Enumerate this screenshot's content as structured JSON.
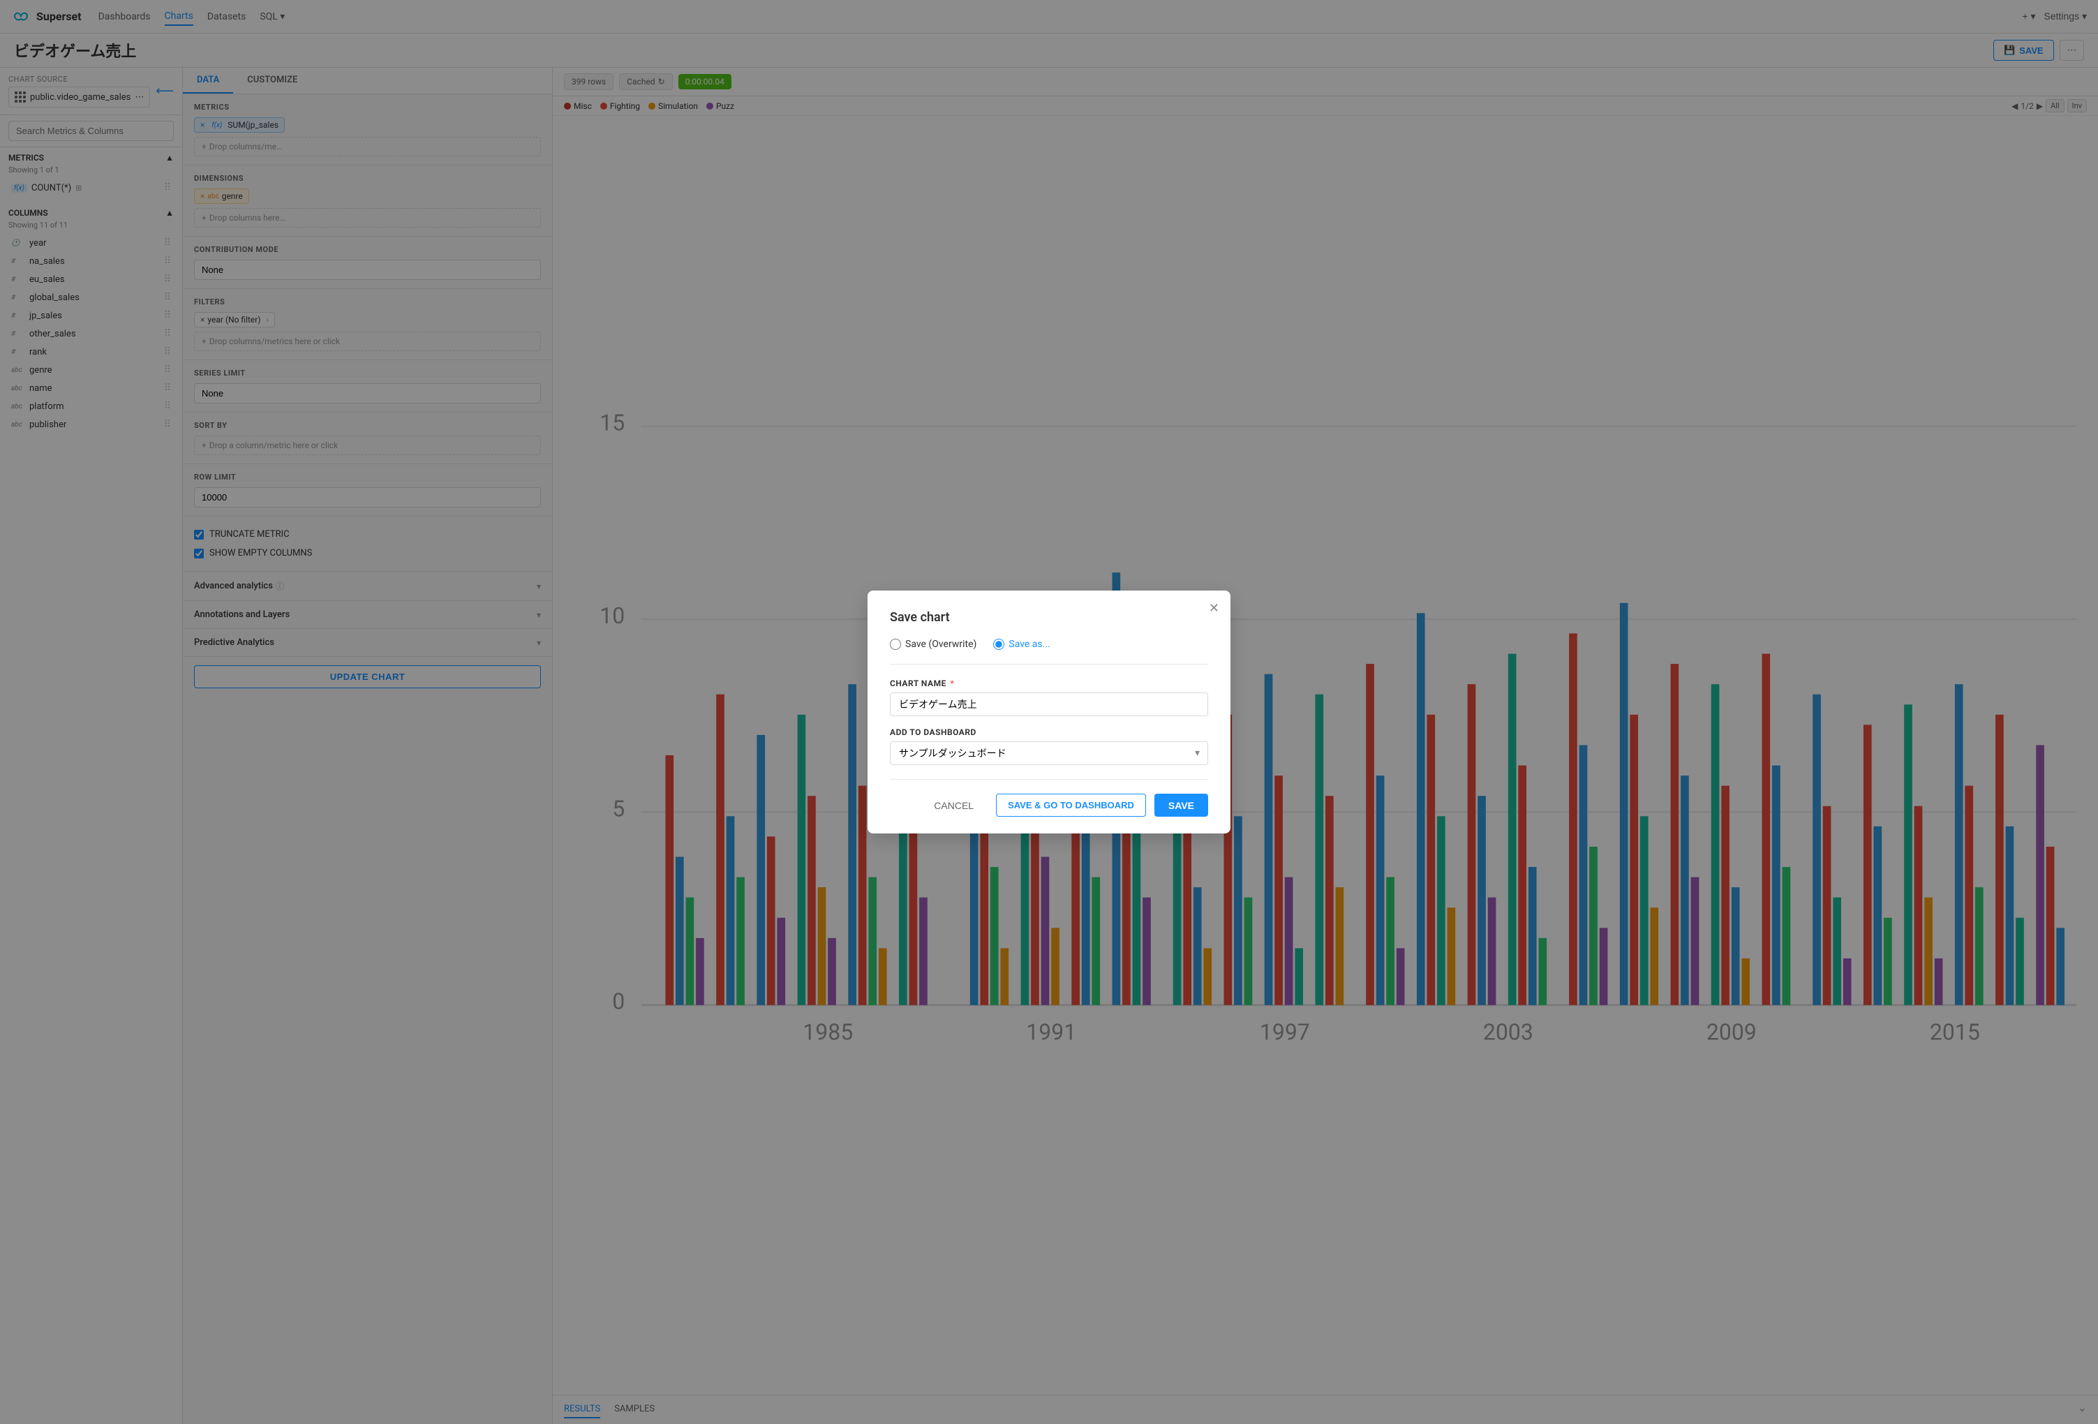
{
  "app": {
    "logo_text": "Superset"
  },
  "nav": {
    "links": [
      {
        "id": "dashboards",
        "label": "Dashboards",
        "active": false
      },
      {
        "id": "charts",
        "label": "Charts",
        "active": true
      },
      {
        "id": "datasets",
        "label": "Datasets",
        "active": false
      },
      {
        "id": "sql",
        "label": "SQL ▾",
        "active": false
      }
    ],
    "right": {
      "add_label": "+ ▾",
      "settings_label": "Settings ▾"
    }
  },
  "page": {
    "title": "ビデオゲーム売上",
    "save_label": "SAVE"
  },
  "sidebar": {
    "source_label": "Chart Source",
    "source_value": "public.video_game_sales",
    "search_placeholder": "Search Metrics & Columns",
    "metrics_label": "Metrics",
    "metrics_count": "Showing 1 of 1",
    "metrics": [
      {
        "label": "COUNT(*)",
        "type": "f(x)"
      }
    ],
    "columns_label": "Columns",
    "columns_count": "Showing 11 of 11",
    "columns": [
      {
        "name": "year",
        "type": "clock"
      },
      {
        "name": "na_sales",
        "type": "#"
      },
      {
        "name": "eu_sales",
        "type": "#"
      },
      {
        "name": "global_sales",
        "type": "#"
      },
      {
        "name": "jp_sales",
        "type": "#"
      },
      {
        "name": "other_sales",
        "type": "#"
      },
      {
        "name": "rank",
        "type": "#"
      },
      {
        "name": "genre",
        "type": "abc"
      },
      {
        "name": "name",
        "type": "abc"
      },
      {
        "name": "platform",
        "type": "abc"
      },
      {
        "name": "publisher",
        "type": "abc"
      }
    ]
  },
  "center": {
    "tabs": [
      "DATA",
      "CUSTOMIZE"
    ],
    "active_tab": "DATA",
    "metrics_label": "METRICS",
    "metric_value": "SUM(jp_sales",
    "dimensions_label": "DIMENSIONS",
    "dimension_value": "genre",
    "contribution_label": "CONTRIBUTION MODE",
    "contribution_value": "None",
    "filters_label": "FILTERS",
    "filter_value": "year (No filter)",
    "filters_drop": "Drop columns/metrics here or click",
    "series_limit_label": "SERIES LIMIT",
    "series_limit_placeholder": "None",
    "sort_by_label": "SORT BY",
    "sort_by_placeholder": "Drop a column/metric here or click",
    "row_limit_label": "ROW LIMIT",
    "row_limit_value": "10000",
    "truncate_label": "TRUNCATE METRIC",
    "show_empty_label": "SHOW EMPTY COLUMNS",
    "advanced_analytics_label": "Advanced analytics",
    "annotations_label": "Annotations and Layers",
    "predictive_label": "Predictive Analytics",
    "update_chart_label": "UPDATE CHART"
  },
  "chart": {
    "rows_label": "399 rows",
    "cached_label": "Cached",
    "time_label": "0:00:00.04",
    "legend": [
      {
        "color": "#e74c3c",
        "label": "Misc"
      },
      {
        "color": "#e74c3c",
        "label": "Fighting"
      },
      {
        "color": "#f39c12",
        "label": "Simulation"
      },
      {
        "color": "#9b59b6",
        "label": "Puzz"
      }
    ],
    "pagination": "1/2",
    "x_labels": [
      "1985",
      "1991",
      "1997",
      "2003",
      "2009",
      "2015"
    ],
    "y_labels": [
      "0",
      "5",
      "10",
      "15"
    ],
    "tabs": [
      "RESULTS",
      "SAMPLES"
    ]
  },
  "modal": {
    "title": "Save chart",
    "radio_overwrite": "Save (Overwrite)",
    "radio_save_as": "Save as...",
    "chart_name_label": "CHART NAME",
    "chart_name_value": "ビデオゲーム売上",
    "dashboard_label": "ADD TO DASHBOARD",
    "dashboard_value": "サンプルダッシュボード",
    "cancel_label": "CANCEL",
    "save_go_label": "SAVE & GO TO DASHBOARD",
    "save_label": "SAVE"
  }
}
